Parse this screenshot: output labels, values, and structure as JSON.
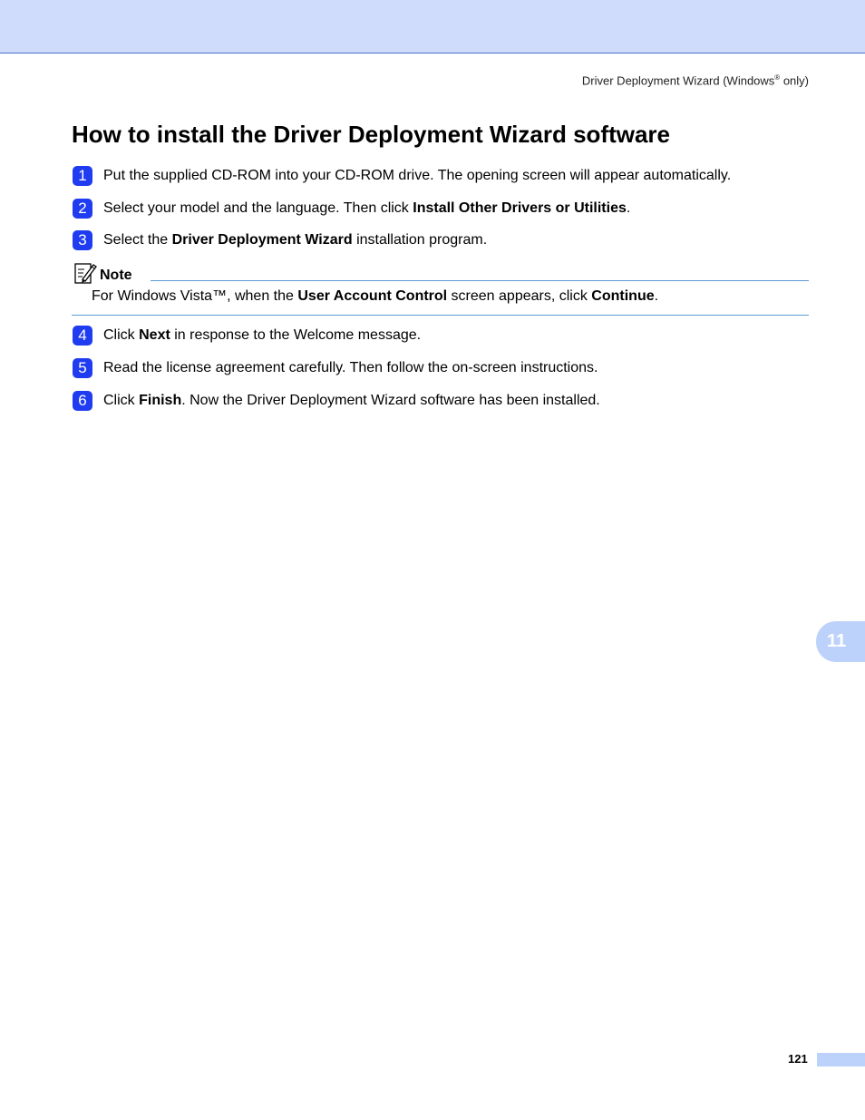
{
  "header": {
    "running_title_pre": "Driver Deployment Wizard (Windows",
    "running_title_sup": "®",
    "running_title_post": " only)"
  },
  "title": "How to install the Driver Deployment Wizard software",
  "steps_before_note": [
    {
      "num": "1",
      "pre": "Put the supplied CD-ROM into your CD-ROM drive. The opening screen will appear automatically.",
      "bold": "",
      "post": ""
    },
    {
      "num": "2",
      "pre": "Select your model and the language. Then click ",
      "bold": "Install Other Drivers or Utilities",
      "post": "."
    },
    {
      "num": "3",
      "pre": "Select the ",
      "bold": "Driver Deployment Wizard",
      "post": " installation program."
    }
  ],
  "note": {
    "icon": "note-pencil-icon",
    "label": "Note",
    "t1": "For Windows Vista™, when the ",
    "b1": "User Account Control",
    "t2": " screen appears, click ",
    "b2": "Continue",
    "t3": "."
  },
  "steps_after_note": [
    {
      "num": "4",
      "pre": "Click ",
      "bold": "Next",
      "post": " in response to the Welcome message."
    },
    {
      "num": "5",
      "pre": "Read the license agreement carefully. Then follow the on-screen instructions.",
      "bold": "",
      "post": ""
    },
    {
      "num": "6",
      "pre": "Click ",
      "bold": "Finish",
      "post": ". Now the Driver Deployment Wizard software has been installed."
    }
  ],
  "chapter_tab": "11",
  "page_number": "121",
  "colors": {
    "header_band": "#cfdcfb",
    "step_badge": "#1f3cf0",
    "rule": "#5b9bd5",
    "tab": "#bdd2fb"
  }
}
